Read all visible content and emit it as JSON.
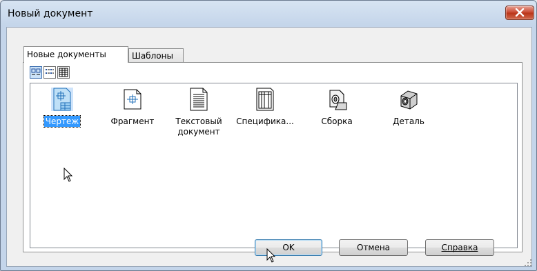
{
  "window": {
    "title": "Новый документ"
  },
  "tabs": [
    {
      "label": "Новые документы",
      "active": true
    },
    {
      "label": "Шаблоны",
      "active": false
    }
  ],
  "view_buttons": [
    "large-icons-view-icon",
    "list-view-icon",
    "details-view-icon"
  ],
  "items": [
    {
      "label": "Чертеж",
      "icon": "drawing-icon",
      "selected": true
    },
    {
      "label": "Фрагмент",
      "icon": "fragment-icon",
      "selected": false
    },
    {
      "label": "Текстовый документ",
      "icon": "text-document-icon",
      "selected": false
    },
    {
      "label": "Специфика...",
      "icon": "specification-icon",
      "selected": false
    },
    {
      "label": "Сборка",
      "icon": "assembly-icon",
      "selected": false
    },
    {
      "label": "Деталь",
      "icon": "part-icon",
      "selected": false
    }
  ],
  "buttons": {
    "ok": "OK",
    "cancel": "Отмена",
    "help": "Справка"
  },
  "colors": {
    "selection": "#3399ff",
    "close_button": "#c7452c"
  }
}
